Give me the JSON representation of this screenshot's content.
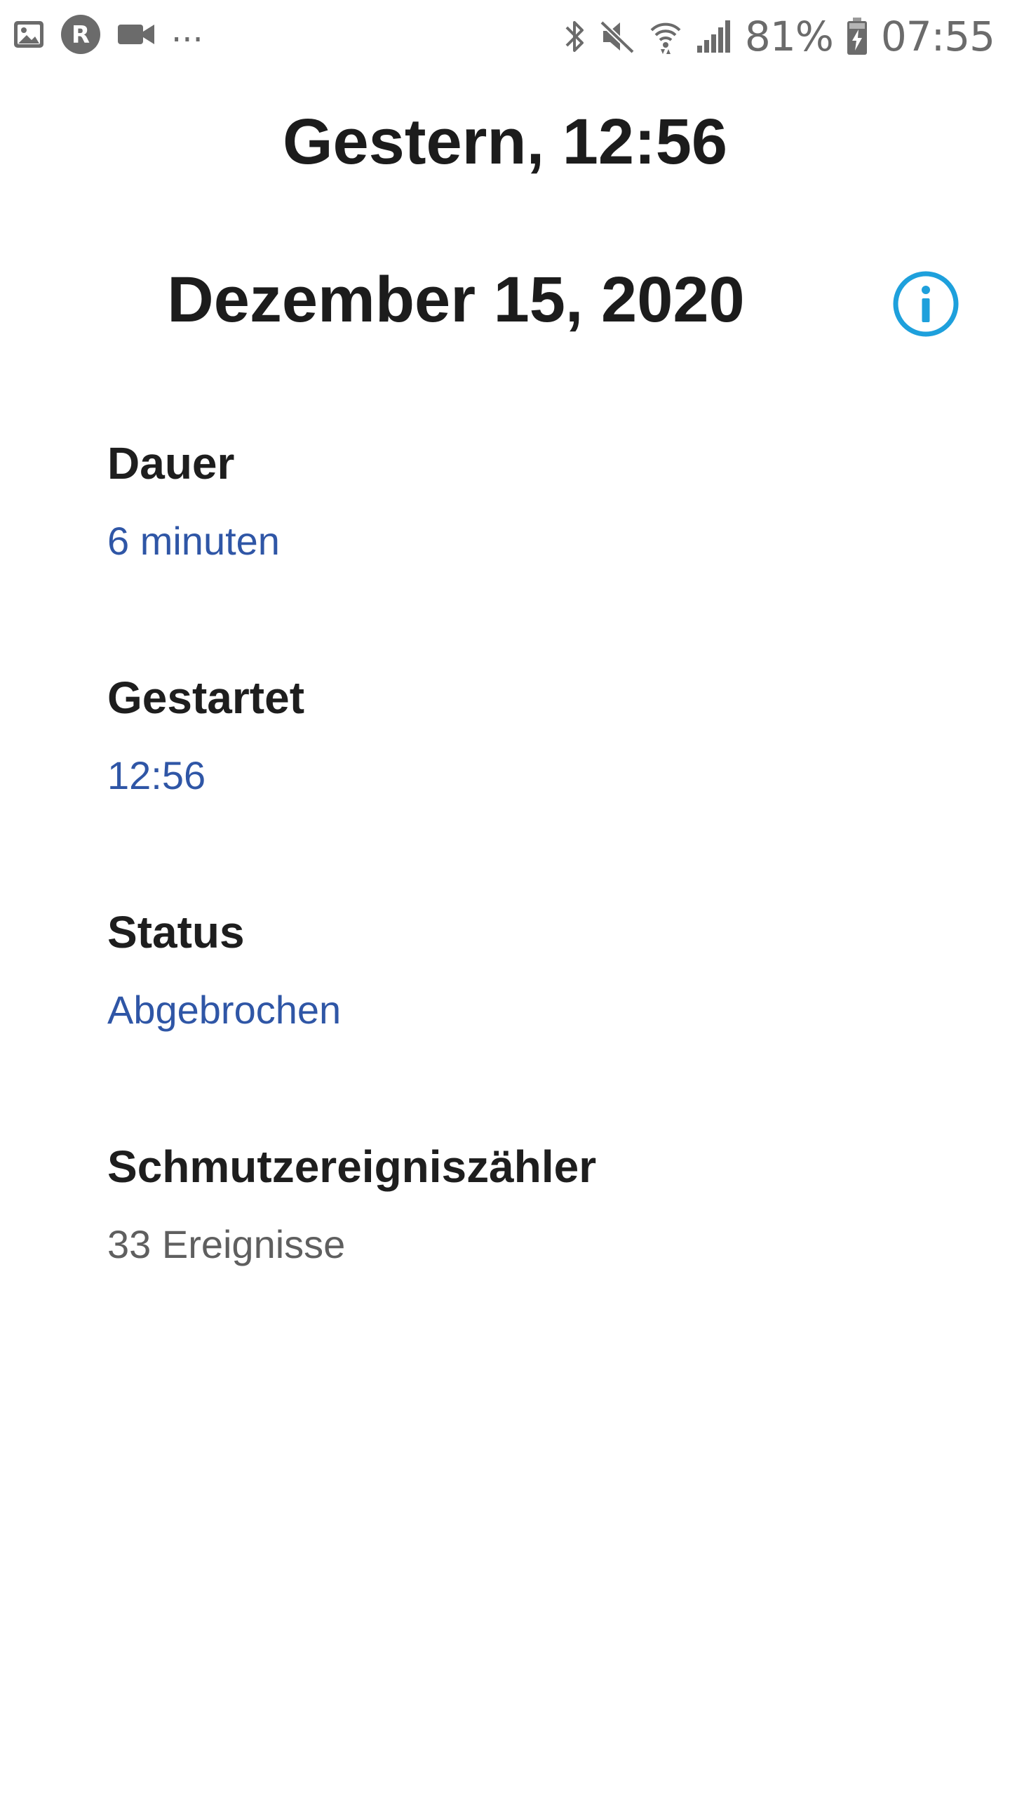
{
  "status_bar": {
    "more_indicator": "...",
    "battery_percent": "81%",
    "time": "07:55",
    "icons_left": [
      "image-icon",
      "r-app-icon",
      "video-camera-icon"
    ],
    "icons_right": [
      "bluetooth-icon",
      "mute-icon",
      "wifi-icon",
      "signal-icon",
      "battery-charging-icon"
    ],
    "icon_color": "#6b6b6b"
  },
  "header": {
    "title": "Gestern, 12:56",
    "date": "Dezember 15, 2020",
    "info_icon": "info-icon",
    "info_color": "#1ea0dc"
  },
  "details": [
    {
      "label": "Dauer",
      "value": "6 minuten"
    },
    {
      "label": "Gestartet",
      "value": "12:56"
    },
    {
      "label": "Status",
      "value": "Abgebrochen"
    },
    {
      "label": "Schmutzereigniszähler",
      "value": "33 Ereignisse"
    }
  ],
  "colors": {
    "link_value": "#2f56a6",
    "plain_value": "#5f5f5f",
    "text": "#1e1e1e"
  }
}
